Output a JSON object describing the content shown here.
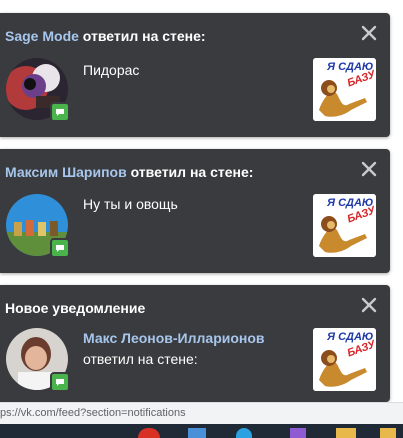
{
  "notifications": [
    {
      "author": "Sage Mode",
      "action": " ответил на стене:",
      "message": "Пидорас",
      "thumb_line1": "Я СДАЮ",
      "thumb_line2": "БАЗУ"
    },
    {
      "author": "Максим Шарипов",
      "action": " ответил на стене:",
      "message": "Ну ты и овощь",
      "thumb_line1": "Я СДАЮ",
      "thumb_line2": "БАЗУ"
    },
    {
      "title": "Новое уведомление",
      "author": "Макс Леонов-Илларионов",
      "message": "ответил на стене:",
      "thumb_line1": "Я СДАЮ",
      "thumb_line2": "БАЗУ"
    }
  ],
  "status_url": "ps://vk.com/feed?section=notifications",
  "icons": {
    "close": "close-icon",
    "badge": "comment-badge-icon"
  },
  "colors": {
    "card_bg": "#3a3b3e",
    "author": "#a7c6ec",
    "badge": "#4bb34b"
  }
}
